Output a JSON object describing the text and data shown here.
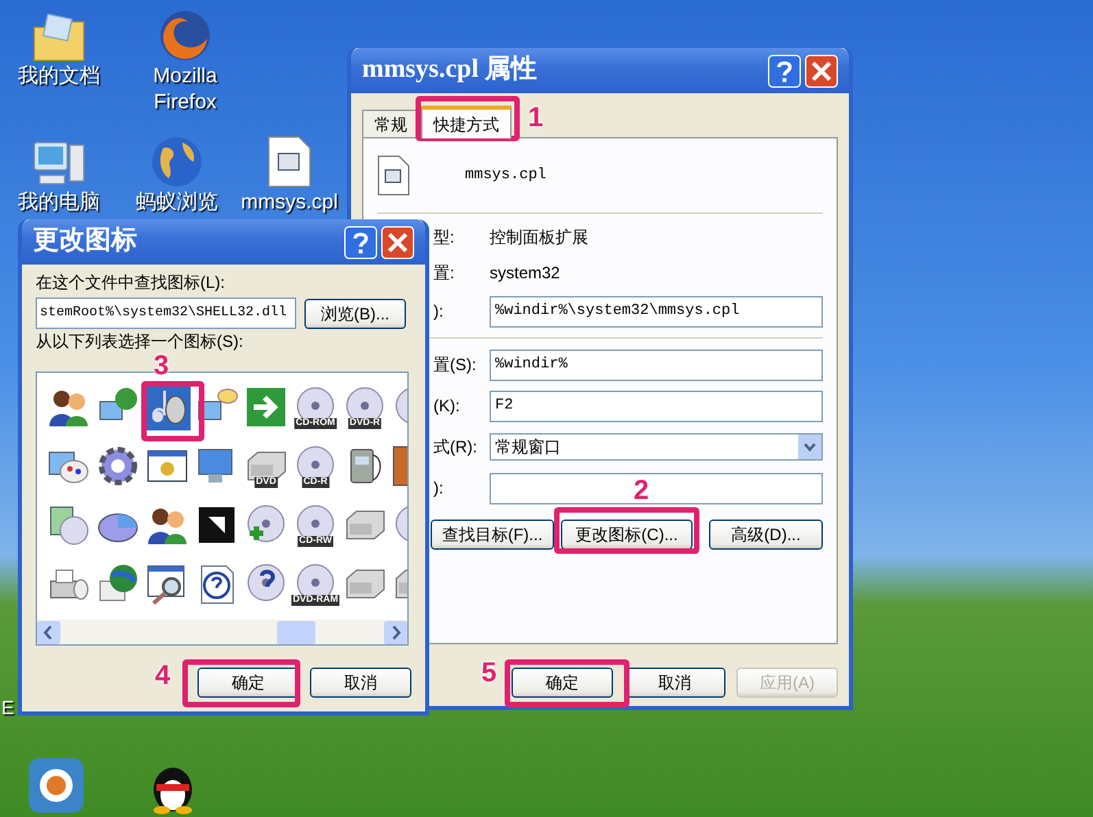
{
  "desktop_icons": [
    {
      "label": "我的文档",
      "kind": "folder"
    },
    {
      "label": "Mozilla Firefox",
      "kind": "firefox"
    },
    {
      "label": "我的电脑",
      "kind": "computer"
    },
    {
      "label": "蚂蚁浏览",
      "kind": "globe"
    },
    {
      "label": "mmsys.cpl",
      "kind": "file"
    },
    {
      "label": "E",
      "kind": "none"
    }
  ],
  "properties_dialog": {
    "title": "mmsys.cpl 属性",
    "tabs": [
      {
        "label": "常规",
        "selected": false
      },
      {
        "label": "快捷方式",
        "selected": true
      }
    ],
    "file_name": "mmsys.cpl",
    "fields": [
      {
        "label": "型:",
        "kind": "text",
        "value": "控制面板扩展"
      },
      {
        "label": "置:",
        "kind": "text",
        "value": "system32"
      },
      {
        "label": "):",
        "kind": "input",
        "value": "%windir%\\system32\\mmsys.cpl"
      },
      {
        "label": "置(S):",
        "kind": "input",
        "value": "%windir%"
      },
      {
        "label": "(K):",
        "kind": "input",
        "value": "F2"
      },
      {
        "label": "式(R):",
        "kind": "select",
        "value": "常规窗口"
      },
      {
        "label": "):",
        "kind": "input"
      }
    ],
    "actions": [
      "查找目标(F)...",
      "更改图标(C)...",
      "高级(D)..."
    ],
    "buttons": [
      {
        "label": "确定",
        "disabled": false
      },
      {
        "label": "取消",
        "disabled": false
      },
      {
        "label": "应用(A)",
        "disabled": true
      }
    ]
  },
  "change_icon_dialog": {
    "title": "更改图标",
    "file_label": "在这个文件中查找图标(L):",
    "file_value": "stemRoot%\\system32\\SHELL32.dll",
    "browse": "浏览(B)...",
    "list_label": "从以下列表选择一个图标(S):",
    "icons": [
      {
        "kind": "people",
        "selected": false
      },
      {
        "kind": "network",
        "selected": false
      },
      {
        "kind": "speaker",
        "selected": true
      },
      {
        "kind": "chat",
        "selected": false
      },
      {
        "kind": "arrow",
        "selected": false
      },
      {
        "kind": "disc",
        "badge": "CD-ROM",
        "selected": false
      },
      {
        "kind": "disc",
        "badge": "DVD-R",
        "selected": false
      },
      {
        "kind": "disc",
        "selected": false
      },
      {
        "kind": "palette",
        "selected": false
      },
      {
        "kind": "gear",
        "selected": false
      },
      {
        "kind": "window",
        "selected": false
      },
      {
        "kind": "monitor",
        "selected": false
      },
      {
        "kind": "drive",
        "badge": "DVD",
        "selected": false
      },
      {
        "kind": "disc",
        "badge": "CD-R",
        "selected": false
      },
      {
        "kind": "device",
        "selected": false
      },
      {
        "kind": "battery",
        "selected": false
      },
      {
        "kind": "install",
        "selected": false
      },
      {
        "kind": "pie",
        "selected": false
      },
      {
        "kind": "people",
        "selected": false
      },
      {
        "kind": "frame",
        "selected": false
      },
      {
        "kind": "discplus",
        "selected": false
      },
      {
        "kind": "disc",
        "badge": "CD-RW",
        "selected": false
      },
      {
        "kind": "drive",
        "selected": false
      },
      {
        "kind": "disc",
        "selected": false
      },
      {
        "kind": "printer",
        "selected": false
      },
      {
        "kind": "globe",
        "selected": false
      },
      {
        "kind": "search",
        "selected": false
      },
      {
        "kind": "help",
        "selected": false
      },
      {
        "kind": "discquestion",
        "selected": false
      },
      {
        "kind": "disc",
        "badge": "DVD-RAM",
        "selected": false
      },
      {
        "kind": "drive",
        "selected": false
      },
      {
        "kind": "drive",
        "selected": false
      }
    ],
    "buttons": [
      {
        "label": "确定",
        "disabled": false
      },
      {
        "label": "取消",
        "disabled": false
      }
    ]
  },
  "annotations": [
    {
      "number": "1"
    },
    {
      "number": "2"
    },
    {
      "number": "3"
    },
    {
      "number": "4"
    },
    {
      "number": "5"
    }
  ]
}
